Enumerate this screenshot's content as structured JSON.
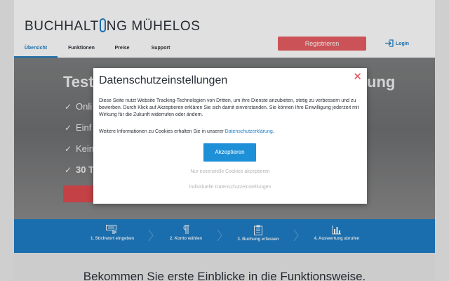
{
  "header": {
    "logo_pre": "BUCHHALT",
    "logo_post": "NG MÜHELOS",
    "nav": [
      {
        "label": "Übersicht",
        "active": true
      },
      {
        "label": "Funktionen",
        "active": false
      },
      {
        "label": "Preise",
        "active": false
      },
      {
        "label": "Support",
        "active": false
      }
    ],
    "register_label": "Registrieren",
    "login_label": "Login"
  },
  "hero": {
    "title_visible": "Testo",
    "title_tail_visible": "ung",
    "features": [
      {
        "text": "Onli",
        "bold": false
      },
      {
        "text": "Einf",
        "bold": false
      },
      {
        "text": "Kein",
        "bold": false
      },
      {
        "text": "30 T",
        "bold": true
      }
    ]
  },
  "steps": [
    {
      "label": "1. Stichwort eingeben",
      "icon": "keyboard-hand-icon"
    },
    {
      "label": "2. Konto wählen",
      "icon": "paragraph-icon"
    },
    {
      "label": "3. Buchung erfassen",
      "icon": "clipboard-icon"
    },
    {
      "label": "4. Auswertung abrufen",
      "icon": "bar-chart-icon"
    }
  ],
  "bottom": {
    "title": "Bekommen Sie erste Einblicke in die Funktionsweise."
  },
  "modal": {
    "title": "Datenschutzeinstellungen",
    "close_glyph": "✕",
    "paragraph1": "Diese Seite nutzt Website Tracking-Technologien von Dritten, um ihre Dienste anzubieten, stetig zu verbessern und zu bewerben. Durch Klick auf Akzeptieren erklären Sie sich damit einverstanden. Sie können Ihre Einwilligung jederzeit mit Wirkung für die Zukunft widerrufen oder ändern.",
    "paragraph2_prefix": "Weitere Informationen zu Cookies erhalten Sie in unserer ",
    "paragraph2_link": "Datenschutzerklärung",
    "paragraph2_suffix": ".",
    "accept_label": "Akzeptieren",
    "essential_label": "Nur essenzielle Cookies akzeptieren",
    "individual_label": "Individuelle Datenschutzeinstellungen"
  },
  "colors": {
    "brand_blue": "#1e7ec5",
    "accept_blue": "#1e90d8",
    "register_red": "#e85f64"
  }
}
